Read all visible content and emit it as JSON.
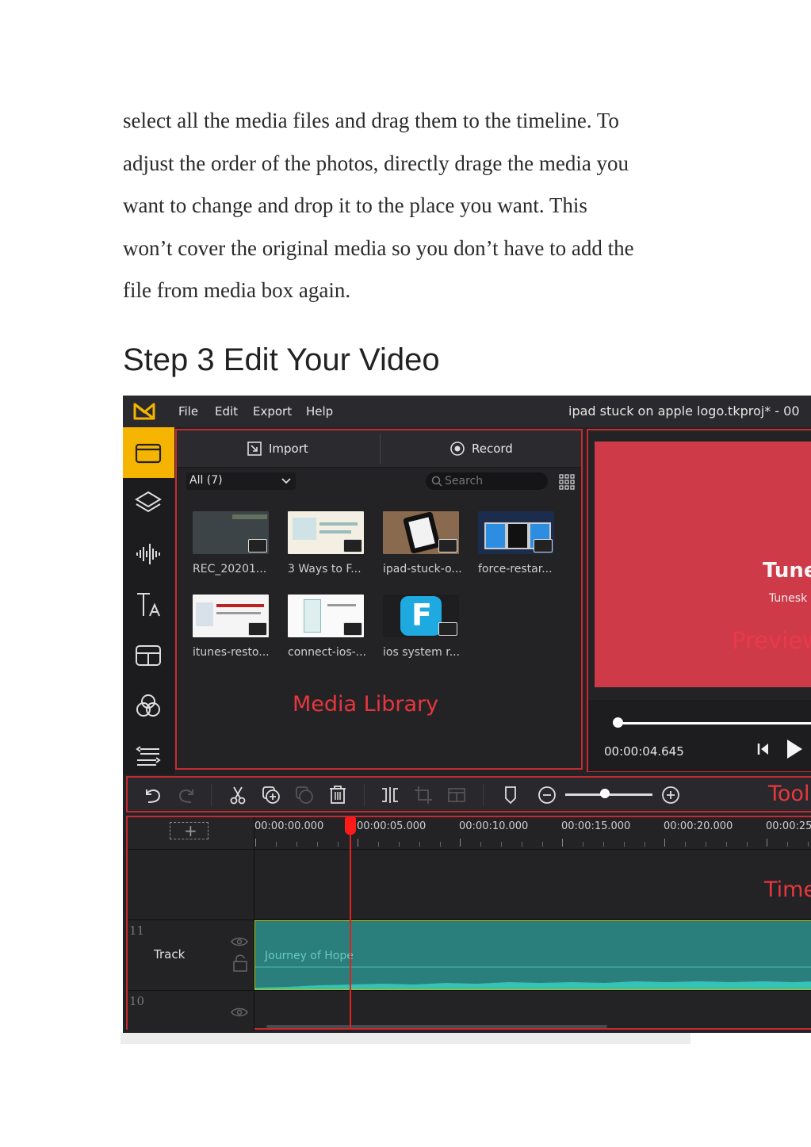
{
  "article": {
    "paragraph_lines": [
      "select all the media files and drag them to the timeline. To",
      "adjust the order of the photos, directly drage the media you",
      "want to change and drop it to the place you want. This",
      "won’t cover the original media so you don’t have to add the",
      "file from media box again."
    ],
    "heading": "Step 3 Edit Your Video"
  },
  "screenshot": {
    "menu": [
      "File",
      "Edit",
      "Export",
      "Help"
    ],
    "window_title": "ipad stuck on apple logo.tkproj* - 00",
    "sidebar_icons": [
      "folder-icon",
      "layers-icon",
      "audio-wave-icon",
      "text-icon",
      "template-icon",
      "filter-icon",
      "transition-icon"
    ],
    "media_library": {
      "import_label": "Import",
      "record_label": "Record",
      "filter_value": "All (7)",
      "search_placeholder": "Search",
      "items": [
        {
          "label": "REC_20201..."
        },
        {
          "label": "3 Ways to F..."
        },
        {
          "label": "ipad-stuck-o..."
        },
        {
          "label": "force-restar..."
        },
        {
          "label": "itunes-resto..."
        },
        {
          "label": "connect-ios-..."
        },
        {
          "label": "ios system r..."
        }
      ],
      "annotation": "Media Library"
    },
    "preview": {
      "title": "Tune",
      "subtitle": "Tunesk",
      "annotation": "Preview",
      "timecode": "00:00:04.645",
      "progress": 0.02
    },
    "toolbar": {
      "annotation": "Tool",
      "zoom_level": 0.45
    },
    "timeline": {
      "ruler_labels": [
        "00:00:00.000",
        "00:00:05.000",
        "00:00:10.000",
        "00:00:15.000",
        "00:00:20.000",
        "00:00:25"
      ],
      "annotation": "Time",
      "tracks": [
        {
          "number": "11",
          "name": "Track"
        },
        {
          "number": "10",
          "name": ""
        }
      ],
      "clip_label": "Journey of Hope",
      "add_track_label": "+"
    },
    "colors": {
      "accent": "#f5b400",
      "annotation_red": "#e9363d",
      "clip": "#2a7f7c",
      "preview_bg": "#cf3a49"
    }
  }
}
